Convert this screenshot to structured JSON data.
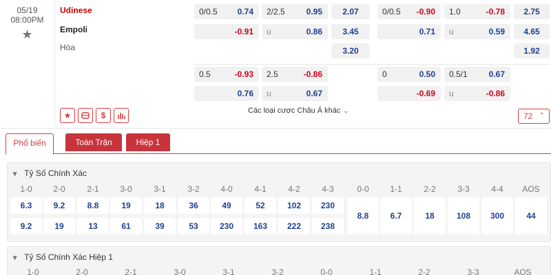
{
  "match": {
    "date": "05/19",
    "time": "08:00PM",
    "home": "Udinese",
    "away": "Empoli",
    "draw": "Hòa"
  },
  "odds": {
    "r1_hdp_line": "0/0.5",
    "r1_hdp_home": "0.74",
    "r1_hdp_away": "-0.91",
    "r1_ou_line": "2/2.5",
    "r1_ou_over": "0.95",
    "r1_ou_u": "u",
    "r1_ou_under": "0.86",
    "r1_1x2_home": "2.07",
    "r1_1x2_away": "3.45",
    "r1_1x2_draw": "3.20",
    "r1_h1_hdp_line": "0/0.5",
    "r1_h1_hdp_home": "-0.90",
    "r1_h1_hdp_away": "0.71",
    "r1_h1_ou_line": "1.0",
    "r1_h1_ou_over": "-0.78",
    "r1_h1_ou_u": "u",
    "r1_h1_ou_under": "0.59",
    "r1_h1_1x2_home": "2.75",
    "r1_h1_1x2_away": "4.65",
    "r1_h1_1x2_draw": "1.92",
    "r2_hdp_line": "0.5",
    "r2_hdp_home": "-0.93",
    "r2_hdp_away": "0.76",
    "r2_ou_line": "2.5",
    "r2_ou_over": "-0.86",
    "r2_ou_u": "u",
    "r2_ou_under": "0.67",
    "r2_h1_hdp_line": "0",
    "r2_h1_hdp_home": "0.50",
    "r2_h1_hdp_away": "-0.69",
    "r2_h1_ou_line": "0.5/1",
    "r2_h1_ou_over": "0.67",
    "r2_h1_ou_u": "u",
    "r2_h1_ou_under": "-0.86"
  },
  "actions": {
    "more_label": "Các loại cược Châu Á khác",
    "count": "72",
    "icon_star": "star-icon",
    "icon_stadium": "stadium-icon",
    "icon_dollar": "dollar-icon",
    "icon_stats": "stats-bars-icon"
  },
  "tabs": [
    "Phổ biến",
    "Toàn Trận",
    "Hiệp 1"
  ],
  "correct_score": {
    "title": "Tỷ Số Chính Xác",
    "home_labels": [
      "1-0",
      "2-0",
      "2-1",
      "3-0",
      "3-1",
      "3-2",
      "4-0",
      "4-1",
      "4-2",
      "4-3"
    ],
    "home_odds": [
      "6.3",
      "9.2",
      "8.8",
      "19",
      "18",
      "36",
      "49",
      "52",
      "102",
      "230"
    ],
    "away_odds": [
      "9.2",
      "19",
      "13",
      "61",
      "39",
      "53",
      "230",
      "163",
      "222",
      "238"
    ],
    "draw_labels": [
      "0-0",
      "1-1",
      "2-2",
      "3-3",
      "4-4",
      "AOS"
    ],
    "draw_odds": [
      "8.8",
      "6.7",
      "18",
      "108",
      "300",
      "44"
    ]
  },
  "correct_score_h1": {
    "title": "Tỷ Số Chính Xác Hiệp 1",
    "labels": [
      "1-0",
      "2-0",
      "2-1",
      "3-0",
      "3-1",
      "3-2",
      "0-0",
      "1-1",
      "2-2",
      "3-3",
      "AOS"
    ]
  },
  "colors": {
    "accent": "#d93b3b",
    "odds_blue": "#1f3f91",
    "negative_red": "#d0021b"
  }
}
